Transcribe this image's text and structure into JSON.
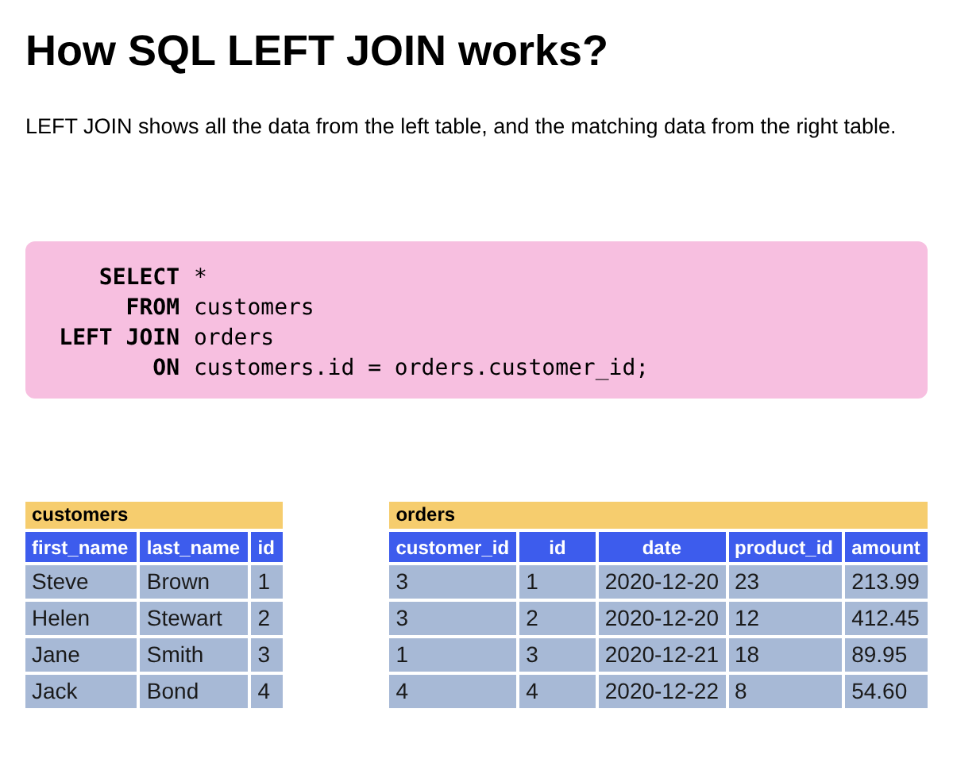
{
  "title": "How SQL LEFT JOIN works?",
  "description": "LEFT JOIN shows all the data from the left table, and the matching data from the right table.",
  "code": [
    {
      "keyword": "SELECT",
      "rest": "*"
    },
    {
      "keyword": "FROM",
      "rest": "customers"
    },
    {
      "keyword": "LEFT JOIN",
      "rest": "orders"
    },
    {
      "keyword": "ON",
      "rest": "customers.id = orders.customer_id;"
    }
  ],
  "tables": [
    {
      "name": "customers",
      "columns": [
        "first_name",
        "last_name",
        "id"
      ],
      "rows": [
        [
          "Steve",
          "Brown",
          "1"
        ],
        [
          "Helen",
          "Stewart",
          "2"
        ],
        [
          "Jane",
          "Smith",
          "3"
        ],
        [
          "Jack",
          "Bond",
          "4"
        ]
      ]
    },
    {
      "name": "orders",
      "columns": [
        "customer_id",
        "id",
        "date",
        "product_id",
        "amount"
      ],
      "rows": [
        [
          "3",
          "1",
          "2020-12-20",
          "23",
          "213.99"
        ],
        [
          "3",
          "2",
          "2020-12-20",
          "12",
          "412.45"
        ],
        [
          "1",
          "3",
          "2020-12-21",
          "18",
          "89.95"
        ],
        [
          "4",
          "4",
          "2020-12-22",
          "8",
          "54.60"
        ]
      ]
    }
  ]
}
